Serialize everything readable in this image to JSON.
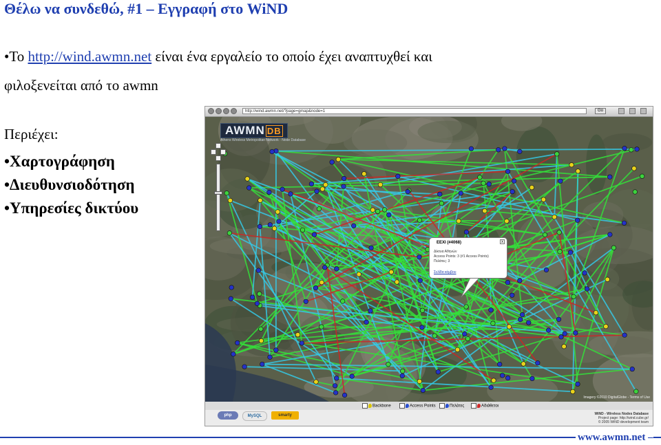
{
  "slide": {
    "title": "Θέλω να συνδεθώ, #1 – Εγγραφή στο WiND",
    "intro_bullet": "•",
    "intro_prefix": "Το ",
    "intro_link": "http://wind.awmn.net",
    "intro_rest": " είναι ένα εργαλείο το οποίο έχει αναπτυχθεί και",
    "intro_line2": "φιλοξενείται από το awmn",
    "contains_label": "Περιέχει:",
    "items": [
      "•Χαρτογράφηση",
      "•Διευθυνσιοδότηση",
      "•Υπηρεσίες δικτύου"
    ],
    "footer_site": "www.awmn.net –"
  },
  "browser": {
    "url": "http://wind.awmn.net/?page=gmap&node=1",
    "go_label": "Go",
    "logo_main": "AWMN",
    "logo_db": "DB",
    "logo_subtitle": "Athens Wireless Metropolitan Network · Node Database",
    "popup": {
      "title": "EEXI (#4068)",
      "line1": "Δίκτυα Αθηνών",
      "line2": "Access Points: 3 (#1 Access Points)",
      "line3": "Πελάτες: 3",
      "link": "Σελίδα κόμβου",
      "close": "x"
    },
    "map_credit": "Imagery ©2010 DigitalGlobe - Terms of Use",
    "legend": [
      {
        "label": "Backbone",
        "color": "#d9c400"
      },
      {
        "label": "Access Points",
        "color": "#2a4fd0"
      },
      {
        "label": "Πελάτες",
        "color": "#2a4fd0"
      },
      {
        "label": "Αδιάθετοι",
        "color": "#d02a2a"
      }
    ],
    "footer_badges": [
      "php",
      "MySQL",
      "smarty"
    ],
    "footer_right": [
      "WiND - Wireless Nodes Database",
      "Project page: http://wind.cube.gr/",
      "© 2005 WiND development team"
    ]
  },
  "colors": {
    "accent": "#1f3fb0",
    "link_green": "#34e03a",
    "link_cyan": "#35c9e6",
    "link_red": "#d02424",
    "node_blue": "#2432c8",
    "node_yellow": "#e8d21c",
    "node_green": "#3dd23d"
  }
}
